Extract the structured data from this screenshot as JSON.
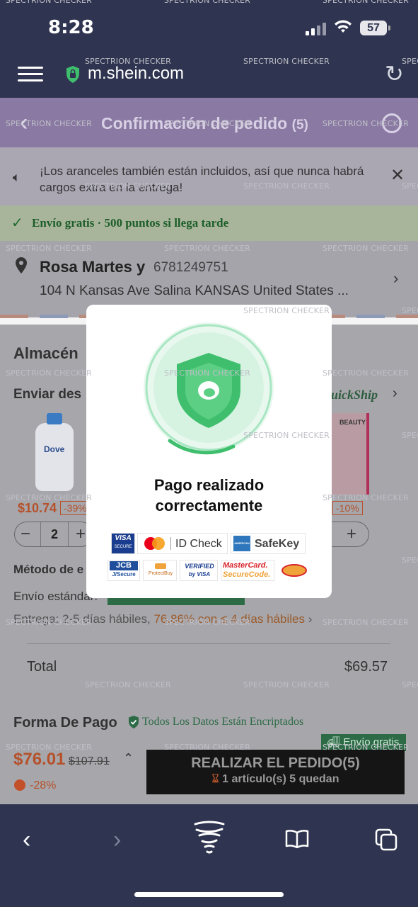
{
  "status": {
    "time": "8:28",
    "battery": "57"
  },
  "browser": {
    "url": "m.shein.com"
  },
  "header": {
    "title": "Confirmación de pedido",
    "count": "(5)"
  },
  "notice": {
    "text": "¡Los aranceles también están incluidos, así que nunca habrá cargos extra en la entrega!"
  },
  "shipping_banner": {
    "text": "Envío gratis · 500 puntos si llega tarde"
  },
  "address": {
    "name": "Rosa Martes y",
    "phone": "6781249751",
    "line": "104 N Kansas Ave Salina KANSAS United States ..."
  },
  "warehouse": {
    "title": "Almacén",
    "send_from": "Enviar des",
    "quickship": "uickShip",
    "item1": {
      "brand": "Dove",
      "price": "$10.74",
      "discount": "-39%",
      "qty": "2"
    },
    "item2": {
      "label": "BEAUTY",
      "discount": "-10%"
    }
  },
  "shipping_method": {
    "title": "Método de e",
    "standard": "Envío estándar:",
    "delivery_prefix": "Entrega: 2-5 días hábiles,",
    "delivery_pct": "76.86% con",
    "delivery_days": "≤ 4 días hábiles",
    "delivery_arrow": "›"
  },
  "totals": {
    "label": "Total",
    "value": "$69.57"
  },
  "payment": {
    "title": "Forma De Pago",
    "encrypted": "Todos Los Datos Están Encriptados"
  },
  "bottom_bar": {
    "free_tag": "Envío gratis",
    "price": "$76.01",
    "original_price": "$107.91",
    "discount": "-28%",
    "order_button": "REALIZAR EL PEDIDO(5)",
    "order_sub_count": "1 artículo(s)",
    "order_sub_rest": "5 quedan"
  },
  "modal": {
    "title_line1": "Pago realizado",
    "title_line2": "correctamente",
    "cards": {
      "visa": "VISA",
      "visa_sub": "SECURE",
      "id_check": "ID Check",
      "safekey": "SafeKey",
      "jcb": "JCB",
      "jcb_sub": "J/Secure",
      "protectbuy": "ProtectBuy",
      "verified1": "VERIFIED",
      "verified2": "by VISA",
      "mc_sc1": "MasterCard.",
      "mc_sc2": "SecureCode.",
      "amex": "AMERICAN EXPRESS"
    }
  },
  "watermark": "SPECTRION CHECKER",
  "watermark_cut": "SPEC",
  "colors": {
    "brand_header": "#8a7aa3",
    "success_green": "#3fbf6e",
    "sale": "#b5512a",
    "browser_chrome": "#2f3550"
  }
}
